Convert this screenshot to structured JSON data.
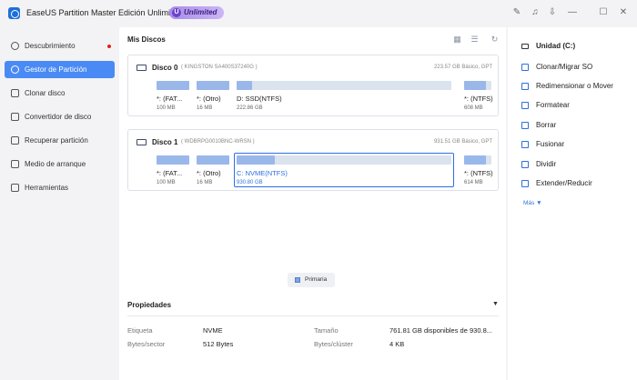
{
  "titlebar": {
    "app_title": "EaseUS Partition Master Edición Unlimited",
    "badge_label": "Unlimited",
    "icons": [
      "notes-icon",
      "bell-icon",
      "download-icon",
      "minimize-icon",
      "maximize-icon",
      "close-icon"
    ]
  },
  "sidebar": {
    "items": [
      {
        "label": "Descubrimiento",
        "icon": "compass-icon",
        "dot": true
      },
      {
        "label": "Gestor de Partición",
        "icon": "pie-chart-icon",
        "active": true
      },
      {
        "label": "Clonar disco",
        "icon": "clone-icon"
      },
      {
        "label": "Convertidor de disco",
        "icon": "convert-icon"
      },
      {
        "label": "Recuperar partición",
        "icon": "recover-icon"
      },
      {
        "label": "Medio de arranque",
        "icon": "boot-media-icon"
      },
      {
        "label": "Herramientas",
        "icon": "toolbox-icon"
      }
    ]
  },
  "main": {
    "title": "Mis Discos",
    "disks": [
      {
        "name": "Disco 0",
        "model": "( KINGSTON SA400S37240G )",
        "info": "223.57 GB Básico, GPT",
        "partitions": [
          {
            "label": "*: (FAT...",
            "size": "100 MB",
            "fill": 1.0
          },
          {
            "label": "*: (Otro)",
            "size": "16 MB",
            "fill": 1.0
          },
          {
            "label": "D: SSD(NTFS)",
            "size": "222.86 GB",
            "fill": 0.07
          },
          {
            "label": "*: (NTFS)",
            "size": "608 MB",
            "fill": 0.8
          }
        ]
      },
      {
        "name": "Disco 1",
        "model": "( WDBRPG0010BNC-WRSN )",
        "info": "931.51 GB Básico, GPT",
        "partitions": [
          {
            "label": "*: (FAT...",
            "size": "100 MB",
            "fill": 1.0
          },
          {
            "label": "*: (Otro)",
            "size": "16 MB",
            "fill": 1.0
          },
          {
            "label": "C: NVME(NTFS)",
            "size": "930.80 GB",
            "fill": 0.18,
            "selected": true
          },
          {
            "label": "*: (NTFS)",
            "size": "614 MB",
            "fill": 0.8
          }
        ]
      }
    ],
    "legend": "Primaria",
    "properties": {
      "title": "Propiedades",
      "toggle": "▼",
      "rows": [
        {
          "key": "Etiqueta",
          "value": "NVME"
        },
        {
          "key": "Bytes/sector",
          "value": "512 Bytes"
        },
        {
          "key": "Tamaño",
          "value": "761.81 GB disponibles de 930.8..."
        },
        {
          "key": "Bytes/clúster",
          "value": "4 KB"
        }
      ]
    }
  },
  "right_panel": {
    "header": "Unidad (C:)",
    "actions": [
      "Clonar/Migrar SO",
      "Redimensionar o Mover",
      "Formatear",
      "Borrar",
      "Fusionar",
      "Dividir",
      "Extender/Reducir"
    ],
    "more": "Más ▼"
  }
}
